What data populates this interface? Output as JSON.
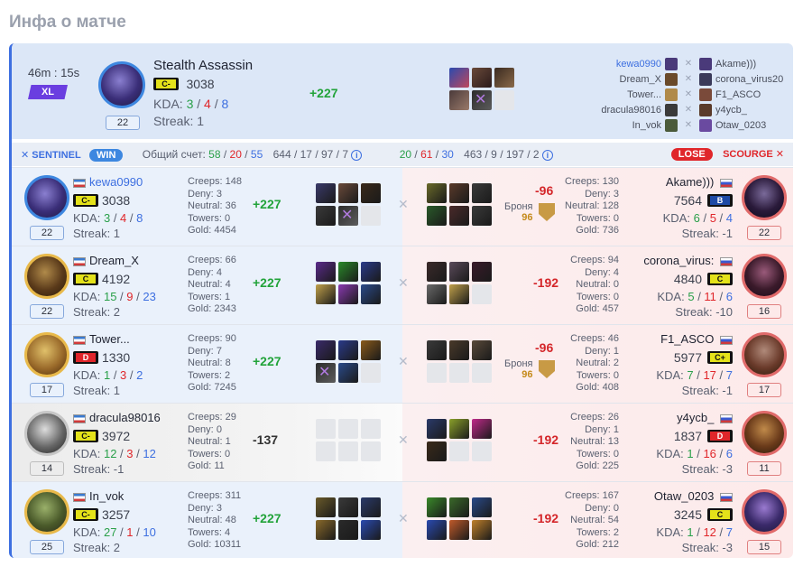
{
  "page_title": "Инфа о матче",
  "match": {
    "duration": "46m : 15s",
    "mode_badge": "XL",
    "hero": {
      "name": "Stealth Assassin",
      "rank": "C-",
      "mmr": "3038",
      "kda_label": "KDA:",
      "k": "3",
      "d": "4",
      "a": "8",
      "streak": "Streak: 1",
      "level": "22",
      "delta": "+227"
    },
    "sentinel_players": [
      "kewa0990",
      "Dream_X",
      "Tower...",
      "dracula98016",
      "In_vok"
    ],
    "scourge_players": [
      "Akame)))",
      "corona_virus20",
      "F1_ASCO",
      "y4ycb_",
      "Otaw_0203"
    ]
  },
  "score_bar": {
    "sentinel_label": "SENTINEL",
    "win_label": "WIN",
    "total_label": "Общий счет:",
    "s_k": "58",
    "s_d": "20",
    "s_a": "55",
    "s_extra": "644 / 17 / 97 / 7",
    "c_k": "20",
    "c_d": "61",
    "c_a": "30",
    "c_extra": "463 / 9 / 197 / 2",
    "lose_label": "LOSE",
    "scourge_label": "SCOURGE"
  },
  "labels": {
    "creeps": "Creeps:",
    "deny": "Deny:",
    "neutral": "Neutral:",
    "towers": "Towers:",
    "gold": "Gold:",
    "kda": "KDA:",
    "armor": "Броня"
  },
  "rows": [
    {
      "left": {
        "name": "kewa0990",
        "rank": "C-",
        "mmr": "3038",
        "k": "3",
        "d": "4",
        "a": "8",
        "streak": "Streak: 1",
        "level": "22",
        "creeps": "148",
        "deny": "3",
        "neutral": "36",
        "towers": "0",
        "gold": "4454",
        "delta": "+227"
      },
      "right": {
        "name": "Akame)))",
        "rank": "B",
        "mmr": "7564",
        "k": "6",
        "d": "5",
        "a": "4",
        "streak": "Streak: -1",
        "level": "22",
        "creeps": "130",
        "deny": "3",
        "neutral": "128",
        "towers": "0",
        "gold": "736",
        "delta": "-96",
        "armor": "96"
      }
    },
    {
      "left": {
        "name": "Dream_X",
        "rank": "C",
        "mmr": "4192",
        "k": "15",
        "d": "9",
        "a": "23",
        "streak": "Streak: 2",
        "level": "22",
        "creeps": "66",
        "deny": "4",
        "neutral": "4",
        "towers": "1",
        "gold": "2343",
        "delta": "+227"
      },
      "right": {
        "name": "corona_virus:",
        "rank": "C",
        "mmr": "4840",
        "k": "5",
        "d": "11",
        "a": "6",
        "streak": "Streak: -10",
        "level": "16",
        "creeps": "94",
        "deny": "4",
        "neutral": "0",
        "towers": "0",
        "gold": "457",
        "delta": "-192"
      }
    },
    {
      "left": {
        "name": "Tower...",
        "rank": "D",
        "mmr": "1330",
        "k": "1",
        "d": "3",
        "a": "2",
        "streak": "Streak: 1",
        "level": "17",
        "creeps": "90",
        "deny": "7",
        "neutral": "8",
        "towers": "2",
        "gold": "7245",
        "delta": "+227"
      },
      "right": {
        "name": "F1_ASCO",
        "rank": "C+",
        "mmr": "5977",
        "k": "7",
        "d": "17",
        "a": "7",
        "streak": "Streak: -1",
        "level": "17",
        "creeps": "46",
        "deny": "1",
        "neutral": "2",
        "towers": "0",
        "gold": "408",
        "delta": "-96",
        "armor": "96"
      }
    },
    {
      "left": {
        "name": "dracula98016",
        "rank": "C-",
        "mmr": "3972",
        "k": "12",
        "d": "3",
        "a": "12",
        "streak": "Streak: -1",
        "level": "14",
        "creeps": "29",
        "deny": "0",
        "neutral": "1",
        "towers": "0",
        "gold": "11",
        "delta": "-137"
      },
      "right": {
        "name": "y4ycb_",
        "rank": "D",
        "mmr": "1837",
        "k": "1",
        "d": "16",
        "a": "6",
        "streak": "Streak: -3",
        "level": "11",
        "creeps": "26",
        "deny": "1",
        "neutral": "13",
        "towers": "0",
        "gold": "225",
        "delta": "-192"
      }
    },
    {
      "left": {
        "name": "In_vok",
        "rank": "C-",
        "mmr": "3257",
        "k": "27",
        "d": "1",
        "a": "10",
        "streak": "Streak: 2",
        "level": "25",
        "creeps": "311",
        "deny": "3",
        "neutral": "48",
        "towers": "4",
        "gold": "10311",
        "delta": "+227"
      },
      "right": {
        "name": "Otaw_0203",
        "rank": "C",
        "mmr": "3245",
        "k": "1",
        "d": "12",
        "a": "7",
        "streak": "Streak: -3",
        "level": "15",
        "creeps": "167",
        "deny": "0",
        "neutral": "54",
        "towers": "2",
        "gold": "212",
        "delta": "-192"
      }
    }
  ]
}
